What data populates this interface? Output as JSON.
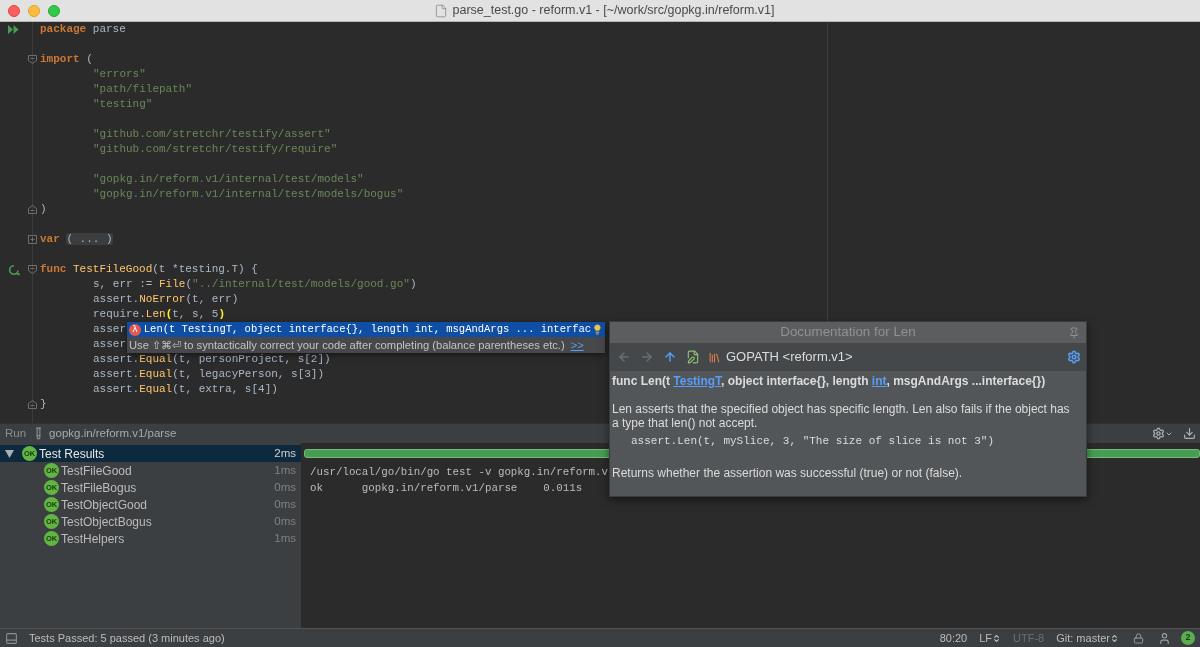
{
  "window": {
    "title": "parse_test.go - reform.v1 - [~/work/src/gopkg.in/reform.v1]"
  },
  "editor": {
    "lines": [
      {
        "kind": "code",
        "gutter": {
          "kind": "run_all"
        },
        "indented": false,
        "tokens": [
          {
            "kind": "keyword",
            "text": "package"
          },
          {
            "kind": "plain",
            "text": " parse"
          }
        ]
      },
      {
        "kind": "blank"
      },
      {
        "kind": "code",
        "fold": {
          "kind": "start"
        },
        "indented": false,
        "tokens": [
          {
            "kind": "keyword",
            "text": "import"
          },
          {
            "kind": "plain",
            "text": " ("
          }
        ]
      },
      {
        "kind": "code",
        "indented": true,
        "tokens": [
          {
            "kind": "string",
            "text": "\"errors\""
          }
        ]
      },
      {
        "kind": "code",
        "indented": true,
        "tokens": [
          {
            "kind": "string",
            "text": "\"path/filepath\""
          }
        ]
      },
      {
        "kind": "code",
        "indented": true,
        "tokens": [
          {
            "kind": "string",
            "text": "\"testing\""
          }
        ]
      },
      {
        "kind": "blank"
      },
      {
        "kind": "code",
        "indented": true,
        "tokens": [
          {
            "kind": "string",
            "text": "\"github.com/stretchr/testify/assert\""
          }
        ]
      },
      {
        "kind": "code",
        "indented": true,
        "tokens": [
          {
            "kind": "string",
            "text": "\"github.com/stretchr/testify/require\""
          }
        ]
      },
      {
        "kind": "blank"
      },
      {
        "kind": "code",
        "indented": true,
        "tokens": [
          {
            "kind": "string",
            "text": "\"gopkg.in/reform.v1/internal/test/models\""
          }
        ]
      },
      {
        "kind": "code",
        "indented": true,
        "tokens": [
          {
            "kind": "string",
            "text": "\"gopkg.in/reform.v1/internal/test/models/bogus\""
          }
        ]
      },
      {
        "kind": "code",
        "fold": {
          "kind": "end"
        },
        "indented": false,
        "tokens": [
          {
            "kind": "plain",
            "text": ")"
          }
        ]
      },
      {
        "kind": "blank"
      },
      {
        "kind": "code",
        "fold": {
          "kind": "collapsed"
        },
        "indented": false,
        "tokens": [
          {
            "kind": "keyword",
            "text": "var "
          },
          {
            "kind": "folded",
            "text": "( ... )"
          }
        ]
      },
      {
        "kind": "blank"
      },
      {
        "kind": "code",
        "gutter": {
          "kind": "run_test"
        },
        "fold": {
          "kind": "start"
        },
        "indented": false,
        "tokens": [
          {
            "kind": "keyword",
            "text": "func "
          },
          {
            "kind": "call",
            "text": "TestFileGood"
          },
          {
            "kind": "plain",
            "text": "(t *testing.T) {"
          }
        ]
      },
      {
        "kind": "code",
        "indented": true,
        "tokens": [
          {
            "kind": "plain",
            "text": "s, err := "
          },
          {
            "kind": "call",
            "text": "File"
          },
          {
            "kind": "plain",
            "text": "("
          },
          {
            "kind": "string",
            "text": "\"../internal/test/models/good.go\""
          },
          {
            "kind": "plain",
            "text": ")"
          }
        ]
      },
      {
        "kind": "code",
        "indented": true,
        "tokens": [
          {
            "kind": "plain",
            "text": "assert."
          },
          {
            "kind": "call",
            "text": "NoError"
          },
          {
            "kind": "plain",
            "text": "(t, err)"
          }
        ]
      },
      {
        "kind": "code",
        "indented": true,
        "tokens": [
          {
            "kind": "plain",
            "text": "require."
          },
          {
            "kind": "call",
            "text": "Len"
          },
          {
            "kind": "brace",
            "text": "("
          },
          {
            "kind": "plain",
            "text": "t, s, 5"
          },
          {
            "kind": "brace",
            "text": ")"
          }
        ]
      },
      {
        "kind": "code",
        "indented": true,
        "tokens": [
          {
            "kind": "plain",
            "text": "asser"
          }
        ]
      },
      {
        "kind": "code",
        "indented": true,
        "tokens": [
          {
            "kind": "plain",
            "text": "asser"
          }
        ]
      },
      {
        "kind": "code",
        "indented": true,
        "tokens": [
          {
            "kind": "plain",
            "text": "assert."
          },
          {
            "kind": "call",
            "text": "Equal"
          },
          {
            "kind": "plain",
            "text": "(t, personProject, s[2])"
          }
        ]
      },
      {
        "kind": "code",
        "indented": true,
        "tokens": [
          {
            "kind": "plain",
            "text": "assert."
          },
          {
            "kind": "call",
            "text": "Equal"
          },
          {
            "kind": "plain",
            "text": "(t, legacyPerson, s[3])"
          }
        ]
      },
      {
        "kind": "code",
        "indented": true,
        "tokens": [
          {
            "kind": "plain",
            "text": "assert."
          },
          {
            "kind": "call",
            "text": "Equal"
          },
          {
            "kind": "plain",
            "text": "(t, extra, s[4])"
          }
        ]
      },
      {
        "kind": "code",
        "fold": {
          "kind": "end"
        },
        "indented": false,
        "tokens": [
          {
            "kind": "plain",
            "text": "}"
          }
        ]
      }
    ]
  },
  "completion": {
    "items": [
      {
        "symbol": "λ",
        "text": "Len(t TestingT, object interface{}, length int, msgAndArgs ... interfac",
        "selected": true
      }
    ],
    "hint": "Use ⇧⌘⏎ to syntactically correct your code after completing (balance parentheses etc.)",
    "hint_link": ">>"
  },
  "documentation": {
    "title": "Documentation for Len",
    "toolbar": [
      {
        "kind": "back",
        "disabled": true
      },
      {
        "kind": "forward",
        "disabled": true
      },
      {
        "kind": "up",
        "disabled": false
      },
      {
        "kind": "edit",
        "disabled": false
      }
    ],
    "location": "GOPATH <reform.v1>",
    "signature": [
      {
        "kind": "text",
        "text": "func Len(t "
      },
      {
        "kind": "link",
        "text": "TestingT"
      },
      {
        "kind": "text",
        "text": ", object interface{}, length "
      },
      {
        "kind": "link",
        "text": "int"
      },
      {
        "kind": "text",
        "text": ", msgAndArgs ...interface{})"
      }
    ],
    "description": "Len asserts that the specified object has specific length. Len also fails if the object has a type that len() not accept.",
    "example": "assert.Len(t, mySlice, 3, \"The size of slice is not 3\")",
    "returns": "Returns whether the assertion was successful (true) or not (false)."
  },
  "run_panel": {
    "label": "Run",
    "config": "gopkg.in/reform.v1/parse",
    "tests": [
      {
        "name": "Test Results",
        "time": "2ms",
        "status": "OK",
        "selected": true,
        "expanded": true,
        "children": [
          {
            "name": "TestFileGood",
            "time": "1ms",
            "status": "OK",
            "selected": false
          },
          {
            "name": "TestFileBogus",
            "time": "0ms",
            "status": "OK",
            "selected": false
          },
          {
            "name": "TestObjectGood",
            "time": "0ms",
            "status": "OK",
            "selected": false
          },
          {
            "name": "TestObjectBogus",
            "time": "0ms",
            "status": "OK",
            "selected": false
          },
          {
            "name": "TestHelpers",
            "time": "1ms",
            "status": "OK",
            "selected": false
          }
        ]
      }
    ],
    "progress": {
      "level": 1
    },
    "console": [
      "/usr/local/go/bin/go test -v gopkg.in/reform.v",
      "ok      gopkg.in/reform.v1/parse    0.011s"
    ]
  },
  "status_bar": {
    "message": "Tests Passed: 5 passed (3 minutes ago)",
    "position": "80:20",
    "line_separator": "LF",
    "encoding": {
      "text": "UTF-8",
      "disabled": true
    },
    "branch": "Git: master",
    "notifications": "2"
  }
}
